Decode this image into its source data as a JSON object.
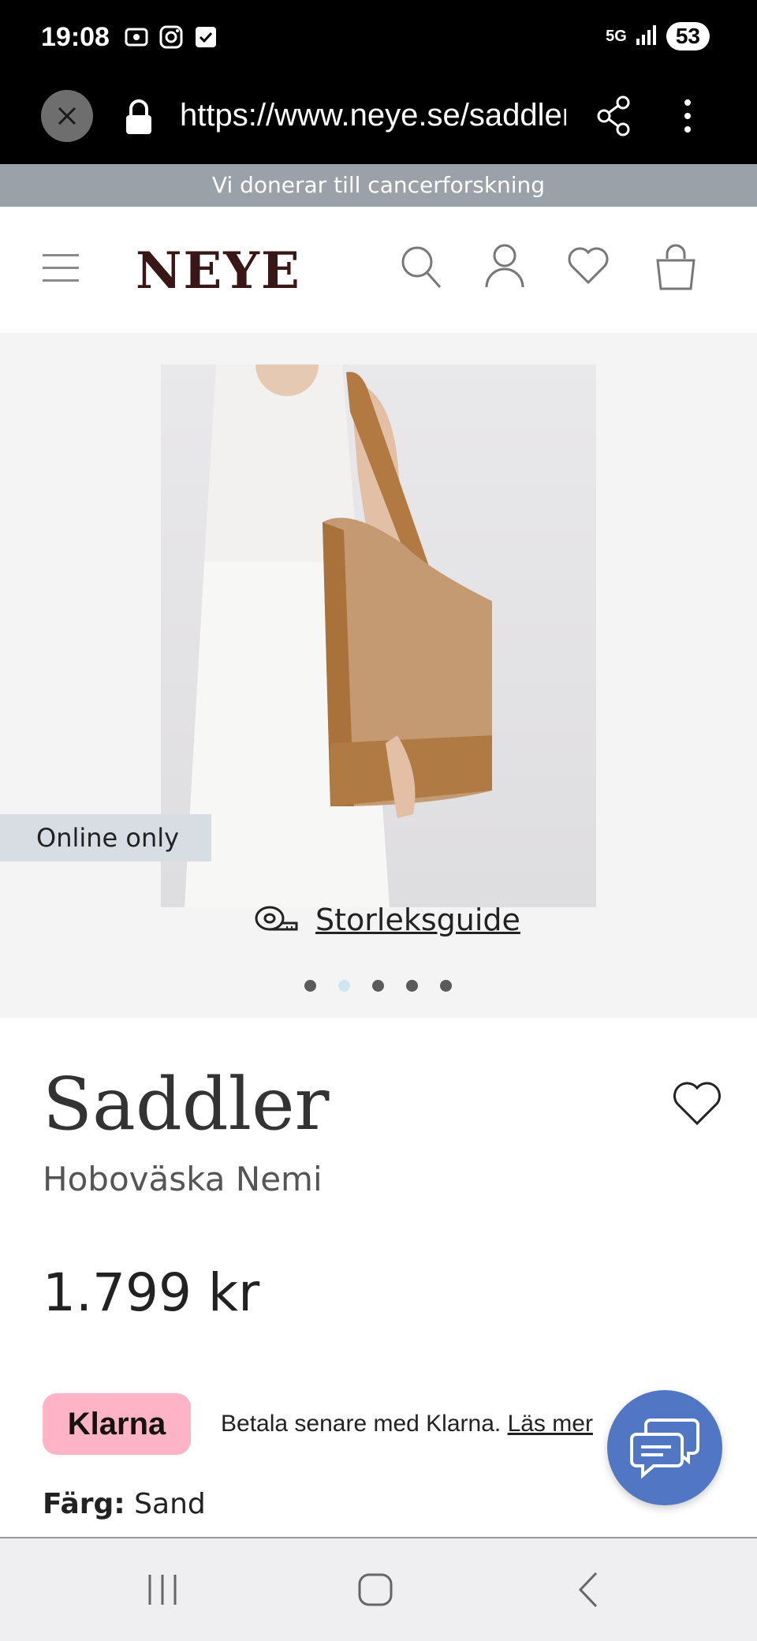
{
  "status_bar": {
    "time": "19:08",
    "network": "5G",
    "battery": "53"
  },
  "browser": {
    "url": "https://www.neye.se/saddler"
  },
  "announcement": "Vi donerar till cancerforskning",
  "header": {
    "logo": "NEYE"
  },
  "gallery": {
    "badge": "Online only",
    "size_guide_label": "Storleksguide",
    "dots_total": 5,
    "active_dot_index": 1
  },
  "product": {
    "brand": "Saddler",
    "name": "Hoboväska Nemi",
    "price": "1.799 kr",
    "klarna_logo": "Klarna",
    "klarna_text": "Betala senare med Klarna.",
    "klarna_link": "Läs mer",
    "color_label": "Färg:",
    "color_value": "Sand"
  },
  "colors": {
    "klarna_pink": "#ffb3c7",
    "chat_blue": "#5076c4",
    "logo_color": "#3a1717",
    "announcement_bg": "#9aa1a8"
  }
}
